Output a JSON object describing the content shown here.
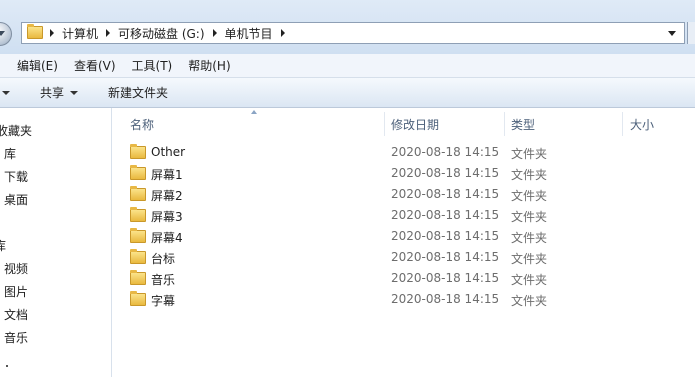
{
  "breadcrumb": {
    "items": [
      "计算机",
      "可移动磁盘 (G:)",
      "单机节目"
    ]
  },
  "menu": {
    "items": [
      "编辑(E)",
      "查看(V)",
      "工具(T)",
      "帮助(H)"
    ]
  },
  "command_bar": {
    "share_label": "共享",
    "new_folder_label": "新建文件夹"
  },
  "nav_pane": {
    "favorites_label": "收藏夹",
    "favorites": [
      "库",
      "下载",
      "桌面"
    ],
    "libraries_label": "库",
    "libraries": [
      "视频",
      "图片",
      "文档",
      "音乐"
    ]
  },
  "columns": {
    "name": "名称",
    "date": "修改日期",
    "type": "类型",
    "size": "大小"
  },
  "files": [
    {
      "name": "Other",
      "date": "2020-08-18 14:15",
      "type": "文件夹"
    },
    {
      "name": "屏幕1",
      "date": "2020-08-18 14:15",
      "type": "文件夹"
    },
    {
      "name": "屏幕2",
      "date": "2020-08-18 14:15",
      "type": "文件夹"
    },
    {
      "name": "屏幕3",
      "date": "2020-08-18 14:15",
      "type": "文件夹"
    },
    {
      "name": "屏幕4",
      "date": "2020-08-18 14:15",
      "type": "文件夹"
    },
    {
      "name": "台标",
      "date": "2020-08-18 14:15",
      "type": "文件夹"
    },
    {
      "name": "音乐",
      "date": "2020-08-18 14:15",
      "type": "文件夹"
    },
    {
      "name": "字幕",
      "date": "2020-08-18 14:15",
      "type": "文件夹"
    }
  ],
  "icons": {
    "back": "back-arrow-icon",
    "folder": "folder-icon",
    "breadcrumb_separator": "chevron-right-icon",
    "address_dropdown": "chevron-down-icon"
  }
}
